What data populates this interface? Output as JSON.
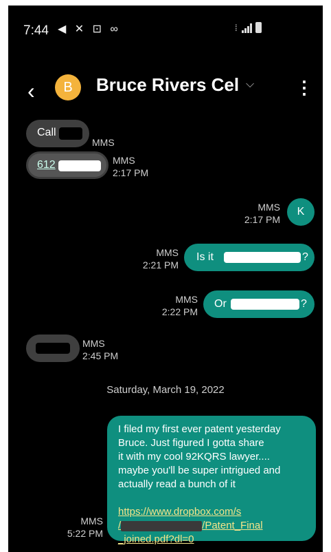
{
  "status": {
    "time": "7:44",
    "left_icons": "◀ ✕ ⊡ ∞",
    "icons": [
      "navigation-icon",
      "missed-call-icon",
      "screenshot-icon",
      "voicemail-icon"
    ]
  },
  "header": {
    "avatar_letter": "B",
    "contact_name": "Bruce Rivers Cel",
    "avatar_color": "#f4b33c"
  },
  "messages": {
    "m1": {
      "text": "Call",
      "meta": "MMS"
    },
    "m2": {
      "text": "612",
      "meta1": "MMS",
      "meta2": "2:17 PM"
    },
    "m3": {
      "text": "K",
      "meta1": "MMS",
      "meta2": "2:17 PM"
    },
    "m4": {
      "text_before": "Is it",
      "text_after": "?",
      "meta1": "MMS",
      "meta2": "2:21 PM"
    },
    "m5": {
      "text_before": "Or",
      "text_after": "?",
      "meta1": "MMS",
      "meta2": "2:22 PM"
    },
    "m6": {
      "meta1": "MMS",
      "meta2": "2:45 PM"
    }
  },
  "date_separator": "Saturday, March 19, 2022",
  "long_message": {
    "line1": "I filed my first ever patent yesterday",
    "line2": "Bruce. Just figured I gotta share",
    "line3": "it with my cool 92KQRS lawyer....",
    "line4": "maybe you'll be super intrigued and",
    "line5": "actually read a bunch of it",
    "link1": "https://www.dropbox.com/s",
    "link2a": "/",
    "link2b": "/Patent_Final",
    "link3": "_joined.pdf?dl=0",
    "meta1": "MMS",
    "meta2": "5:22 PM"
  },
  "colors": {
    "incoming": "#3f3f3f",
    "outgoing": "#0f8f7f",
    "link": "#f5e58a"
  }
}
